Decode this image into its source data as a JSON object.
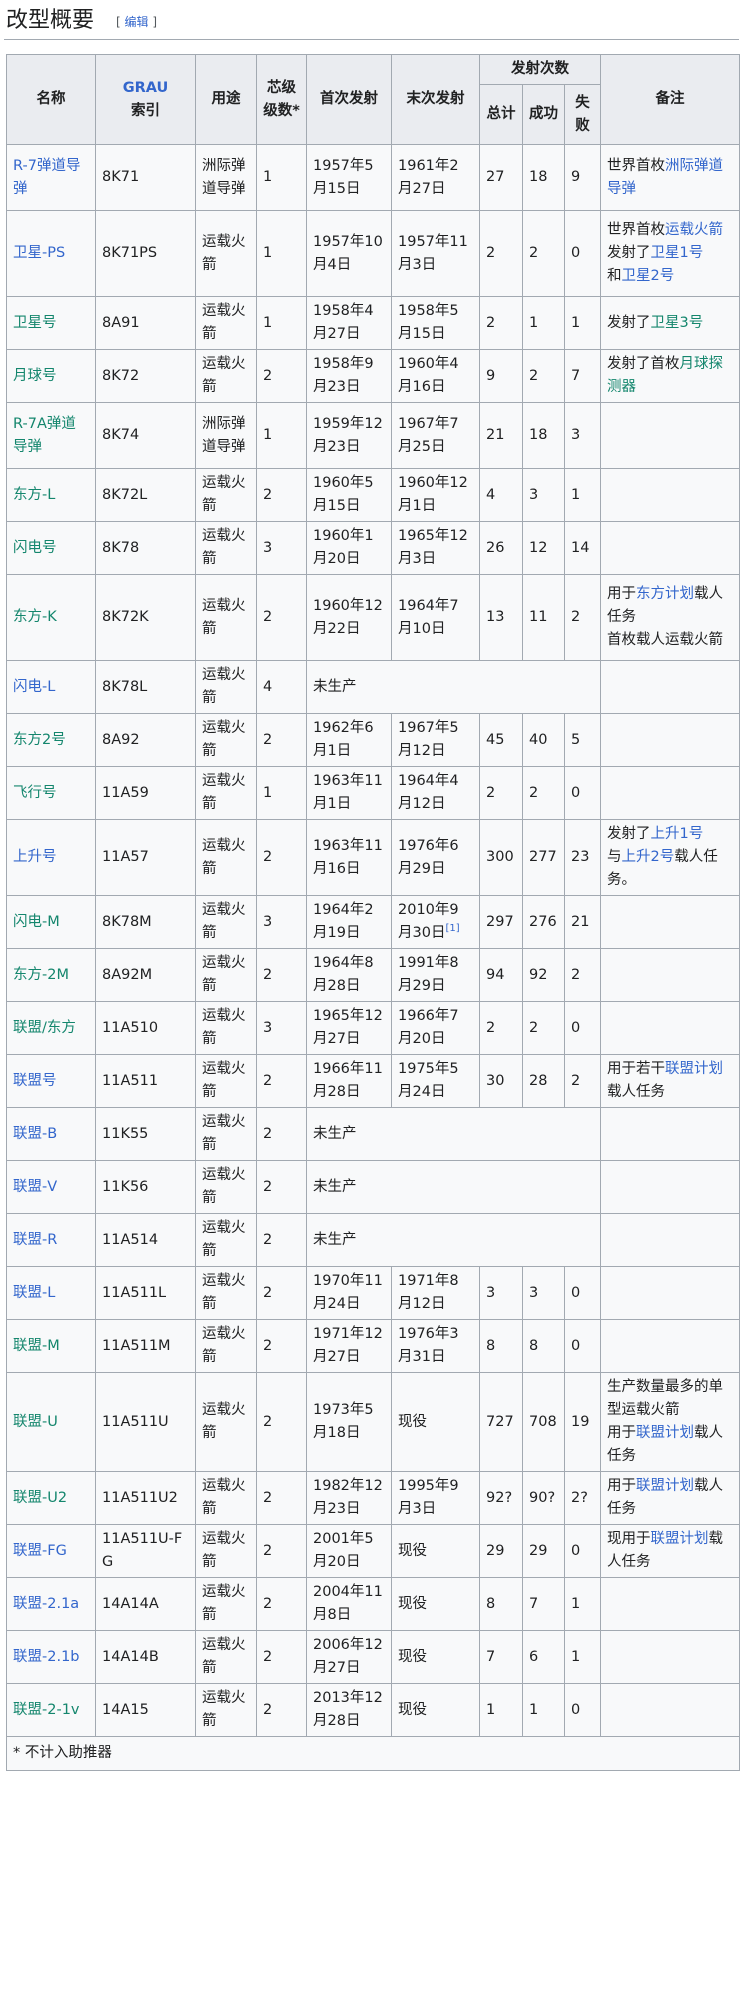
{
  "section": {
    "title": "改型概要",
    "edit_bracket_open": "[",
    "edit_label": "编辑",
    "edit_bracket_close": "]"
  },
  "headers": {
    "name": "名称",
    "grau_link": "GRAU",
    "grau_rest": "索引",
    "use": "用途",
    "stages": "芯级级数*",
    "first": "首次发射",
    "last": "末次发射",
    "launches": "发射次数",
    "total": "总计",
    "success": "成功",
    "fail": "失败",
    "notes": "备注"
  },
  "rows": [
    {
      "name": "R-7弹道导弹",
      "grau": "8K71",
      "use": "洲际弹道导弹",
      "stages": "1",
      "first": "1957年5月15日",
      "last": "1961年2月27日",
      "total": "27",
      "success": "18",
      "fail": "9",
      "notes": [
        {
          "t": "世界首枚"
        },
        {
          "t": "洲际弹道导弹",
          "c": "blue"
        }
      ]
    },
    {
      "name": "卫星-PS",
      "grau": "8K71PS",
      "use": "运载火箭",
      "stages": "1",
      "first": "1957年10月4日",
      "last": "1957年11月3日",
      "total": "2",
      "success": "2",
      "fail": "0",
      "notes": [
        {
          "t": "世界首枚"
        },
        {
          "t": "运载火箭",
          "c": "blue"
        },
        {
          "br": true
        },
        {
          "t": "发射了"
        },
        {
          "t": "卫星1号",
          "c": "blue"
        },
        {
          "br": true
        },
        {
          "t": "和"
        },
        {
          "t": "卫星2号",
          "c": "blue"
        }
      ]
    },
    {
      "name": "卫星号",
      "grau": "8A91",
      "use": "运载火箭",
      "stages": "1",
      "first": "1958年4月27日",
      "last": "1958年5月15日",
      "total": "2",
      "success": "1",
      "fail": "1",
      "notes": [
        {
          "t": "发射了"
        },
        {
          "t": "卫星3号",
          "c": "green"
        }
      ]
    },
    {
      "name": "月球号",
      "grau": "8K72",
      "use": "运载火箭",
      "stages": "2",
      "first": "1958年9月23日",
      "last": "1960年4月16日",
      "total": "9",
      "success": "2",
      "fail": "7",
      "notes": [
        {
          "t": "发射了首枚"
        },
        {
          "t": "月球探测器",
          "c": "green"
        }
      ]
    },
    {
      "name": "R-7A弹道导弹",
      "grau": "8K74",
      "use": "洲际弹道导弹",
      "stages": "1",
      "first": "1959年12月23日",
      "last": "1967年7月25日",
      "total": "21",
      "success": "18",
      "fail": "3",
      "notes": []
    },
    {
      "name": "东方-L",
      "grau": "8K72L",
      "use": "运载火箭",
      "stages": "2",
      "first": "1960年5月15日",
      "last": "1960年12月1日",
      "total": "4",
      "success": "3",
      "fail": "1",
      "notes": []
    },
    {
      "name": "闪电号",
      "grau": "8K78",
      "use": "运载火箭",
      "stages": "3",
      "first": "1960年1月20日",
      "last": "1965年12月3日",
      "total": "26",
      "success": "12",
      "fail": "14",
      "notes": []
    },
    {
      "name": "东方-K",
      "grau": "8K72K",
      "use": "运载火箭",
      "stages": "2",
      "first": "1960年12月22日",
      "last": "1964年7月10日",
      "total": "13",
      "success": "11",
      "fail": "2",
      "notes": [
        {
          "t": "用于"
        },
        {
          "t": "东方计划",
          "c": "blue"
        },
        {
          "t": "载人任务"
        },
        {
          "br": true
        },
        {
          "t": "首枚载人运载火箭"
        }
      ]
    },
    {
      "name": "闪电-L",
      "grau": "8K78L",
      "use": "运载火箭",
      "stages": "4",
      "np": "未生产",
      "notes": []
    },
    {
      "name": "东方2号",
      "grau": "8A92",
      "use": "运载火箭",
      "stages": "2",
      "first": "1962年6月1日",
      "last": "1967年5月12日",
      "total": "45",
      "success": "40",
      "fail": "5",
      "notes": []
    },
    {
      "name": "飞行号",
      "grau": "11A59",
      "use": "运载火箭",
      "stages": "1",
      "first": "1963年11月1日",
      "last": "1964年4月12日",
      "total": "2",
      "success": "2",
      "fail": "0",
      "notes": []
    },
    {
      "name": "上升号",
      "grau": "11A57",
      "use": "运载火箭",
      "stages": "2",
      "first": "1963年11月16日",
      "last": "1976年6月29日",
      "total": "300",
      "success": "277",
      "fail": "23",
      "notes": [
        {
          "t": "发射了"
        },
        {
          "t": "上升1号",
          "c": "blue"
        },
        {
          "br": true
        },
        {
          "t": "与"
        },
        {
          "t": "上升2号",
          "c": "blue"
        },
        {
          "t": "载人任务。"
        }
      ]
    },
    {
      "name": "闪电-M",
      "grau": "8K78M",
      "use": "运载火箭",
      "stages": "3",
      "first": "1964年2月19日",
      "last": "2010年9月30日",
      "ref": "[1]",
      "total": "297",
      "success": "276",
      "fail": "21",
      "notes": []
    },
    {
      "name": "东方-2M",
      "grau": "8A92M",
      "use": "运载火箭",
      "stages": "2",
      "first": "1964年8月28日",
      "last": "1991年8月29日",
      "total": "94",
      "success": "92",
      "fail": "2",
      "notes": []
    },
    {
      "name": "联盟/东方",
      "grau": "11A510",
      "use": "运载火箭",
      "stages": "3",
      "first": "1965年12月27日",
      "last": "1966年7月20日",
      "total": "2",
      "success": "2",
      "fail": "0",
      "notes": []
    },
    {
      "name": "联盟号",
      "grau": "11A511",
      "use": "运载火箭",
      "stages": "2",
      "first": "1966年11月28日",
      "last": "1975年5月24日",
      "total": "30",
      "success": "28",
      "fail": "2",
      "notes": [
        {
          "t": "用于若干"
        },
        {
          "t": "联盟计划",
          "c": "blue"
        },
        {
          "t": "载人任务"
        }
      ]
    },
    {
      "name": "联盟-B",
      "grau": "11K55",
      "use": "运载火箭",
      "stages": "2",
      "np": "未生产",
      "notes": []
    },
    {
      "name": "联盟-V",
      "grau": "11K56",
      "use": "运载火箭",
      "stages": "2",
      "np": "未生产",
      "notes": []
    },
    {
      "name": "联盟-R",
      "grau": "11A514",
      "use": "运载火箭",
      "stages": "2",
      "np": "未生产",
      "notes": []
    },
    {
      "name": "联盟-L",
      "grau": "11A511L",
      "use": "运载火箭",
      "stages": "2",
      "first": "1970年11月24日",
      "last": "1971年8月12日",
      "total": "3",
      "success": "3",
      "fail": "0",
      "notes": []
    },
    {
      "name": "联盟-M",
      "grau": "11A511M",
      "use": "运载火箭",
      "stages": "2",
      "first": "1971年12月27日",
      "last": "1976年3月31日",
      "total": "8",
      "success": "8",
      "fail": "0",
      "notes": []
    },
    {
      "name": "联盟-U",
      "grau": "11A511U",
      "use": "运载火箭",
      "stages": "2",
      "first": "1973年5月18日",
      "last": "现役",
      "total": "727",
      "success": "708",
      "fail": "19",
      "notes": [
        {
          "t": "生产数量最多的单型运载火箭"
        },
        {
          "br": true
        },
        {
          "t": "用于"
        },
        {
          "t": "联盟计划",
          "c": "blue"
        },
        {
          "t": "载人任务"
        }
      ]
    },
    {
      "name": "联盟-U2",
      "grau": "11A511U2",
      "use": "运载火箭",
      "stages": "2",
      "first": "1982年12月23日",
      "last": "1995年9月3日",
      "total": "92?",
      "success": "90?",
      "fail": "2?",
      "notes": [
        {
          "t": "用于"
        },
        {
          "t": "联盟计划",
          "c": "blue"
        },
        {
          "t": "载人任务"
        }
      ]
    },
    {
      "name": "联盟-FG",
      "grau": "11A511U-FG",
      "use": "运载火箭",
      "stages": "2",
      "first": "2001年5月20日",
      "last": "现役",
      "total": "29",
      "success": "29",
      "fail": "0",
      "notes": [
        {
          "t": "现用于"
        },
        {
          "t": "联盟计划",
          "c": "blue"
        },
        {
          "t": "载人任务"
        }
      ]
    },
    {
      "name": "联盟-2.1a",
      "grau": "14A14A",
      "use": "运载火箭",
      "stages": "2",
      "first": "2004年11月8日",
      "last": "现役",
      "total": "8",
      "success": "7",
      "fail": "1",
      "notes": []
    },
    {
      "name": "联盟-2.1b",
      "grau": "14A14B",
      "use": "运载火箭",
      "stages": "2",
      "first": "2006年12月27日",
      "last": "现役",
      "total": "7",
      "success": "6",
      "fail": "1",
      "notes": []
    },
    {
      "name": "联盟-2-1v",
      "grau": "14A15",
      "use": "运载火箭",
      "stages": "2",
      "first": "2013年12月28日",
      "last": "现役",
      "total": "1",
      "success": "1",
      "fail": "0",
      "notes": []
    }
  ],
  "name_colors": [
    "blue",
    "blue",
    "green",
    "green",
    "green",
    "green",
    "green",
    "green",
    "blue",
    "green",
    "green",
    "blue",
    "green",
    "green",
    "green",
    "blue",
    "blue",
    "blue",
    "blue",
    "blue",
    "green",
    "green",
    "green",
    "blue",
    "blue",
    "blue",
    "green"
  ],
  "footnote": "* 不计入助推器",
  "colors": {
    "link_blue": "#3366cc",
    "link_green": "#14866d",
    "header_bg": "#eaecf0",
    "cell_bg": "#f8f9fa",
    "border": "#a2a9b1"
  }
}
